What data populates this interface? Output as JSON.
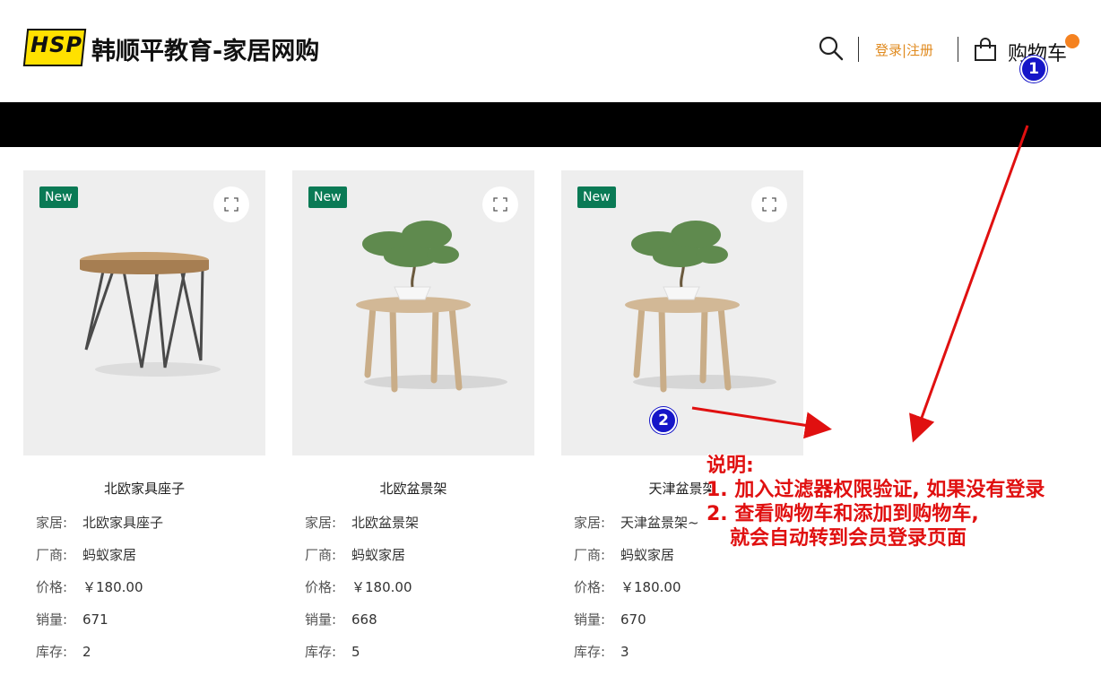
{
  "header": {
    "logo_text": "HSP",
    "site_title": "韩顺平教育-家居网购",
    "login_label": "登录|注册",
    "cart_label": "购物车"
  },
  "products": [
    {
      "badge": "New",
      "name": "北欧家具座子",
      "fields": [
        {
          "k": "家居:",
          "v": "北欧家具座子"
        },
        {
          "k": "厂商:",
          "v": "蚂蚁家居"
        },
        {
          "k": "价格:",
          "v": "￥180.00"
        },
        {
          "k": "销量:",
          "v": "671"
        },
        {
          "k": "库存:",
          "v": "2"
        }
      ]
    },
    {
      "badge": "New",
      "name": "北欧盆景架",
      "fields": [
        {
          "k": "家居:",
          "v": "北欧盆景架"
        },
        {
          "k": "厂商:",
          "v": "蚂蚁家居"
        },
        {
          "k": "价格:",
          "v": "￥180.00"
        },
        {
          "k": "销量:",
          "v": "668"
        },
        {
          "k": "库存:",
          "v": "5"
        }
      ]
    },
    {
      "badge": "New",
      "name": "天津盆景架",
      "fields": [
        {
          "k": "家居:",
          "v": "天津盆景架~"
        },
        {
          "k": "厂商:",
          "v": "蚂蚁家居"
        },
        {
          "k": "价格:",
          "v": "￥180.00"
        },
        {
          "k": "销量:",
          "v": "670"
        },
        {
          "k": "库存:",
          "v": "3"
        }
      ]
    }
  ],
  "annotations": {
    "badge1": "1",
    "badge2": "2",
    "note_lines": [
      "说明:",
      "1. 加入过滤器权限验证, 如果没有登录",
      "2. 查看购物车和添加到购物车,",
      "就会自动转到会员登录页面"
    ]
  },
  "colors": {
    "accent_orange": "#e08a1e",
    "badge_green": "#0a7a55",
    "annotation_red": "#e01010",
    "annotation_blue": "#1616c8"
  }
}
